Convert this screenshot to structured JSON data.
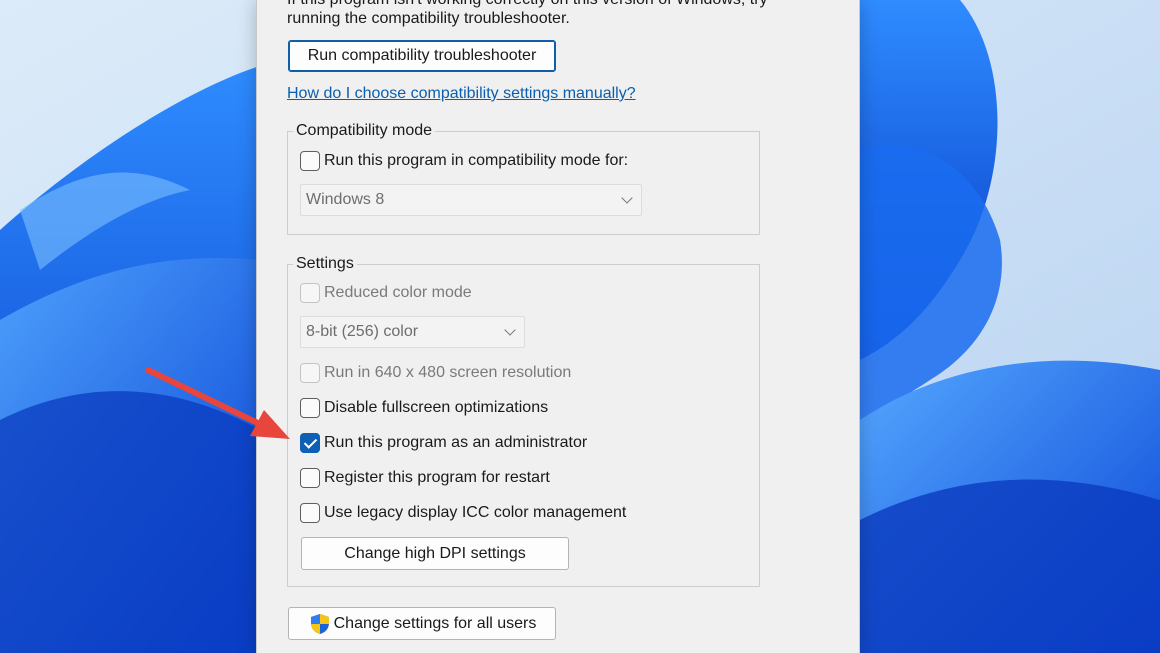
{
  "intro": {
    "line1": "If this program isn't working correctly on this version of Windows, try",
    "line2": "running the compatibility troubleshooter."
  },
  "troubleshooter_button": "Run compatibility troubleshooter",
  "help_link": "How do I choose compatibility settings manually?",
  "compatibility_mode": {
    "legend": "Compatibility mode",
    "checkbox_label": "Run this program in compatibility mode for:",
    "checked": false,
    "os_select": "Windows 8"
  },
  "settings": {
    "legend": "Settings",
    "reduced_color": {
      "label": "Reduced color mode",
      "checked": false,
      "enabled": false
    },
    "color_select": "8-bit (256) color",
    "res_640": {
      "label": "Run in 640 x 480 screen resolution",
      "checked": false,
      "enabled": false
    },
    "fullscreen_opt": {
      "label": "Disable fullscreen optimizations",
      "checked": false
    },
    "run_as_admin": {
      "label": "Run this program as an administrator",
      "checked": true
    },
    "register_restart": {
      "label": "Register this program for restart",
      "checked": false
    },
    "legacy_icc": {
      "label": "Use legacy display ICC color management",
      "checked": false
    },
    "dpi_button": "Change high DPI settings"
  },
  "all_users_button": "Change settings for all users",
  "colors": {
    "accent": "#0f5fb4",
    "link": "#0a5fb0",
    "annotation_arrow": "#e8463c"
  },
  "icons": {
    "shield": "uac-shield-icon",
    "arrow": "red-annotation-arrow"
  }
}
